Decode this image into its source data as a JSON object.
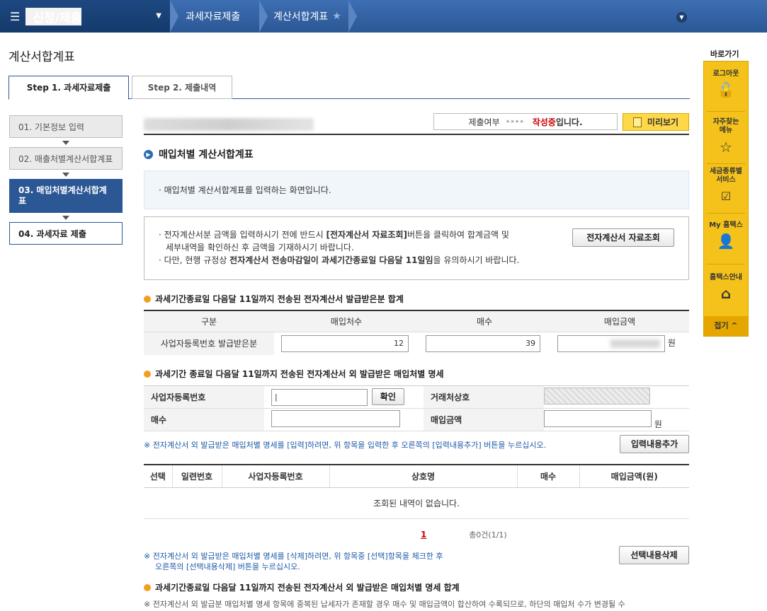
{
  "nav": {
    "menu_label": "신청/제출",
    "crumb1": "과세자료제출",
    "crumb2": "계산서합계표"
  },
  "page": {
    "title": "계산서합계표"
  },
  "tabs": {
    "step1": "Step 1. 과세자료제출",
    "step2": "Step 2. 제출내역"
  },
  "steps": [
    "01. 기본정보 입력",
    "02. 매출처별계산서합계표",
    "03. 매입처별계산서합계표",
    "04. 과세자료 제출"
  ],
  "status": {
    "label": "제출여부",
    "arrows": "▸▸▸▸",
    "value": "작성중",
    "suffix": "입니다."
  },
  "preview_label": "미리보기",
  "section": {
    "title": "매입처별 계산서합계표"
  },
  "info1": "· 매입처별 계산서합계표를 입력하는 화면입니다.",
  "info2": {
    "line1a": "· 전자계산서분 금액을 입력하시기 전에 반드시 ",
    "line1b": "[전자계산서 자료조회]",
    "line1c": "버튼을 클릭하여 합계금액 및",
    "line2": "세부내역을 확인하신 후 금액을 기재하시기 바랍니다.",
    "line3a": "· 다만, 현행 규정상 ",
    "line3b": "전자계산서 전송마감일이 과세기간종료일 다음달 11일임",
    "line3c": "을 유의하시기 바랍니다.",
    "button": "전자계산서 자료조회"
  },
  "summary": {
    "title": "과세기간종료일 다음달 11일까지 전송된 전자계산서 발급받은분 합계",
    "headers": [
      "구분",
      "매입처수",
      "매수",
      "매입금액"
    ],
    "row_label": "사업자등록번호 발급받은분",
    "count": "12",
    "sheets": "39",
    "won": "원"
  },
  "detail": {
    "title": "과세기간 종료일 다음달 11일까지 전송된 전자계산서 외 발급받은 매입처별 명세",
    "bizno_label": "사업자등록번호",
    "confirm": "확인",
    "trader_label": "거래처상호",
    "sheets_label": "매수",
    "amount_label": "매입금액",
    "won": "원",
    "note": "※ 전자계산서 외 발급받은 매입처별 명세를 [입력]하려면, 위 항목을 입력한 후 오른쪽의 [입력내용추가] 버튼을 누르십시오.",
    "add_button": "입력내용추가"
  },
  "list": {
    "headers": [
      "선택",
      "일련번호",
      "사업자등록번호",
      "상호명",
      "매수",
      "매입금액(원)"
    ],
    "empty": "조회된 내역이 없습니다.",
    "page": "1",
    "total": "총0건(1/1)",
    "note1": "※ 전자계산서 외 발급받은 매입처별 명세를 [삭제]하려면, 위 항목중 [선택]항목을 체크한 후",
    "note2": "오른쪽의 [선택내용삭제] 버튼을 누르십시오.",
    "delete_button": "선택내용삭제"
  },
  "bottom": {
    "title": "과세기간종료일 다음달 11일까지 전송된 전자계산서 외 발급받은 매입처별 명세 합계",
    "note": "※ 전자계산서 외 발급분 매입처별 명세 항목에 중복된 납세자가 존재할 경우 매수 및 매입금액이 합산하여 수록되므로, 하단의 매입처 수가 변경될 수"
  },
  "quick": {
    "title": "바로가기",
    "items": [
      "로그아웃",
      "자주찾는 메뉴",
      "세금종류별 서비스",
      "My 홈택스",
      "홈택스안내"
    ],
    "fold": "접기 ^"
  }
}
